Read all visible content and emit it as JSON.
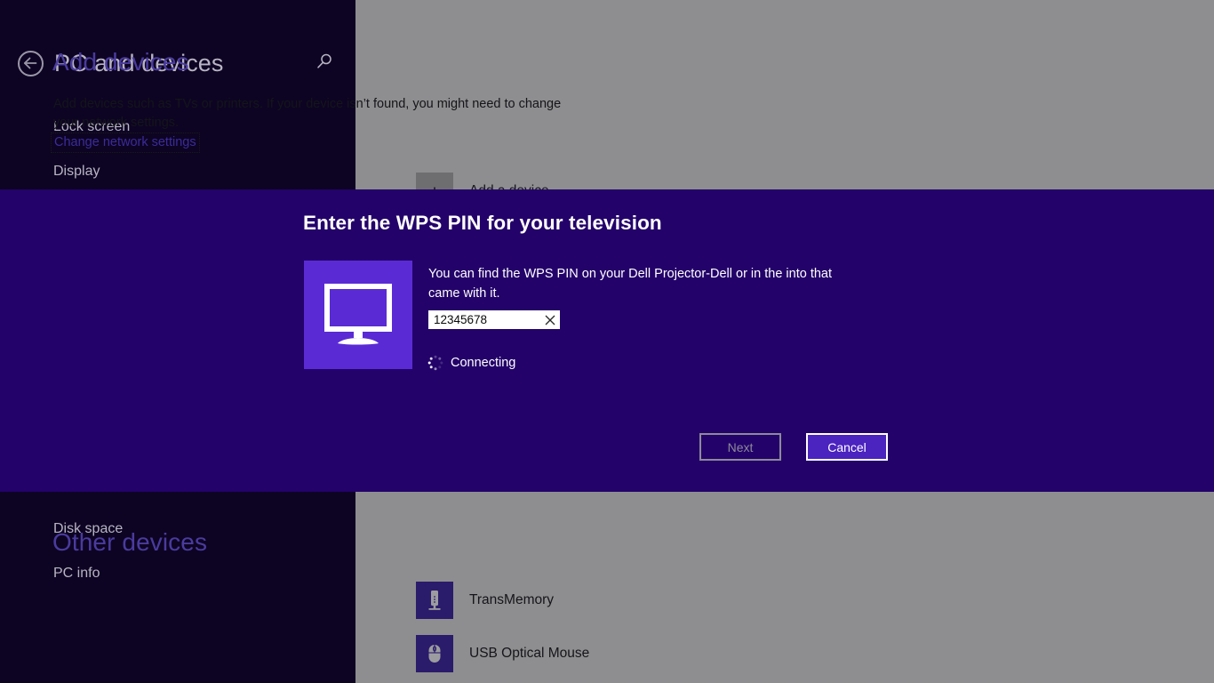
{
  "sidebar": {
    "title": "PC and devices",
    "back_icon": "back-arrow-icon",
    "search_icon": "search-icon",
    "items_top": [
      {
        "label": "Lock screen"
      },
      {
        "label": "Display"
      }
    ],
    "items_bottom": [
      {
        "label": "Disk space"
      },
      {
        "label": "PC info"
      }
    ]
  },
  "main": {
    "add_devices_heading": "Add devices",
    "description": "Add devices such as TVs or printers. If your device isn’t found, you might need to change your network settings.",
    "change_network_link": "Change network settings",
    "add_a_device": {
      "label": "Add a device",
      "icon": "plus-icon"
    },
    "other_devices_heading": "Other devices",
    "other_devices": [
      {
        "label": "TransMemory",
        "icon": "usb-flash-drive-icon"
      },
      {
        "label": "USB Optical Mouse",
        "icon": "mouse-icon"
      }
    ]
  },
  "dialog": {
    "title": "Enter the WPS PIN for your television",
    "device_icon": "television-icon",
    "body": "You can find the WPS PIN on your Dell Projector-Dell or in the into that came with it.",
    "pin_value": "12345678",
    "pin_placeholder": "",
    "clear_icon": "clear-x-icon",
    "status_icon": "loading-spinner-icon",
    "status_text": "Connecting",
    "next_label": "Next",
    "cancel_label": "Cancel"
  },
  "colors": {
    "sidebar_bg": "#0d0423",
    "content_bg": "#8e8e90",
    "dialog_bg": "#23026a",
    "accent_heading": "#4a3b9e",
    "tv_tile": "#5a2bd4",
    "primary_button_bg": "#4b23bf",
    "link": "#3c2b9a"
  }
}
